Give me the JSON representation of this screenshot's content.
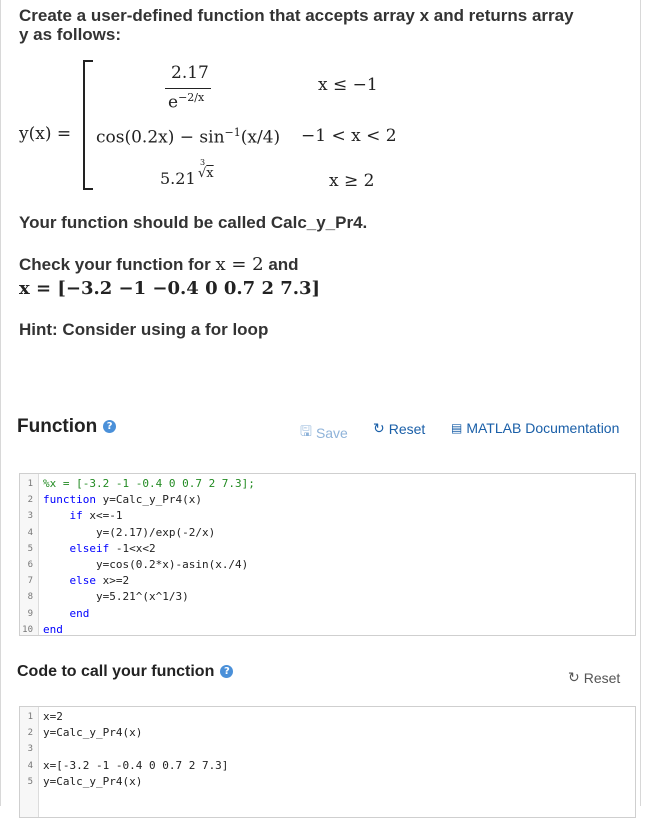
{
  "problem": {
    "title": "Create a user-defined function that accepts array x and returns array y as follows:",
    "eq": {
      "lhs": "y(x) =",
      "case1_num": "2.17",
      "case1_den": "e",
      "case1_den_exp": "−2/x",
      "case1_cond": "x ≤ −1",
      "case2_expr": "cos(0.2x) − sin",
      "case2_exp": "−1",
      "case2_tail": "(x/4)",
      "case2_cond": "−1 < x < 2",
      "case3_coef": "5.21",
      "case3_root_index": "3",
      "case3_radicand": "x",
      "case3_cond": "x ≥ 2"
    },
    "function_name_text": "Your function should be called Calc_y_Pr4.",
    "check_text": "Check your function for",
    "check_math1": "x = 2",
    "check_and": "and",
    "check_math2": "x = [−3.2   −1   −0.4   0   0.7   2   7.3]",
    "hint": "Hint: Consider using a for loop"
  },
  "function_section": {
    "title": "Function",
    "help_icon": "?",
    "save_label": "Save",
    "save_icon": "save-icon",
    "reset_label": "Reset",
    "reset_icon": "reset-icon",
    "doc_label": "MATLAB Documentation",
    "doc_icon": "book-icon"
  },
  "function_code": [
    {
      "n": "1",
      "indent": "",
      "parts": [
        {
          "t": "cm",
          "v": "%x = [-3.2 -1 -0.4 0 0.7 2 7.3];"
        }
      ]
    },
    {
      "n": "2",
      "indent": "",
      "parts": [
        {
          "t": "kw",
          "v": "function"
        },
        {
          "t": "tx",
          "v": " y=Calc_y_Pr4(x)"
        }
      ]
    },
    {
      "n": "3",
      "indent": "    ",
      "parts": [
        {
          "t": "kw",
          "v": "if"
        },
        {
          "t": "tx",
          "v": " x<=-1"
        }
      ]
    },
    {
      "n": "4",
      "indent": "        ",
      "parts": [
        {
          "t": "tx",
          "v": "y=(2.17)/exp(-2/x)"
        }
      ]
    },
    {
      "n": "5",
      "indent": "    ",
      "parts": [
        {
          "t": "kw",
          "v": "elseif"
        },
        {
          "t": "tx",
          "v": " -1<x<2"
        }
      ]
    },
    {
      "n": "6",
      "indent": "        ",
      "parts": [
        {
          "t": "tx",
          "v": "y=cos(0.2*x)-asin(x./4)"
        }
      ]
    },
    {
      "n": "7",
      "indent": "    ",
      "parts": [
        {
          "t": "kw",
          "v": "else"
        },
        {
          "t": "tx",
          "v": " x>=2"
        }
      ]
    },
    {
      "n": "8",
      "indent": "        ",
      "parts": [
        {
          "t": "tx",
          "v": "y=5.21^(x^1/3)"
        }
      ]
    },
    {
      "n": "9",
      "indent": "    ",
      "parts": [
        {
          "t": "kw",
          "v": "end"
        }
      ]
    },
    {
      "n": "10",
      "indent": "",
      "parts": [
        {
          "t": "kw",
          "v": "end"
        }
      ]
    }
  ],
  "call_section": {
    "title": "Code to call your function",
    "help_icon": "?",
    "reset_label": "Reset",
    "reset_icon": "reset-icon"
  },
  "call_code": [
    {
      "n": "1",
      "indent": "",
      "parts": [
        {
          "t": "tx",
          "v": "x=2"
        }
      ]
    },
    {
      "n": "2",
      "indent": "",
      "parts": [
        {
          "t": "tx",
          "v": "y=Calc_y_Pr4(x)"
        }
      ]
    },
    {
      "n": "3",
      "indent": "",
      "parts": [
        {
          "t": "tx",
          "v": ""
        }
      ]
    },
    {
      "n": "4",
      "indent": "",
      "parts": [
        {
          "t": "tx",
          "v": "x=[-3.2 -1 -0.4 0 0.7 2 7.3]"
        }
      ]
    },
    {
      "n": "5",
      "indent": "",
      "parts": [
        {
          "t": "tx",
          "v": "y=Calc_y_Pr4(x)"
        }
      ]
    }
  ],
  "colors": {
    "link": "#1a5fa8",
    "save_disabled": "#8fb3d9",
    "keyword": "#0000ff",
    "comment": "#228b22",
    "help_icon": "#4a90d9"
  }
}
